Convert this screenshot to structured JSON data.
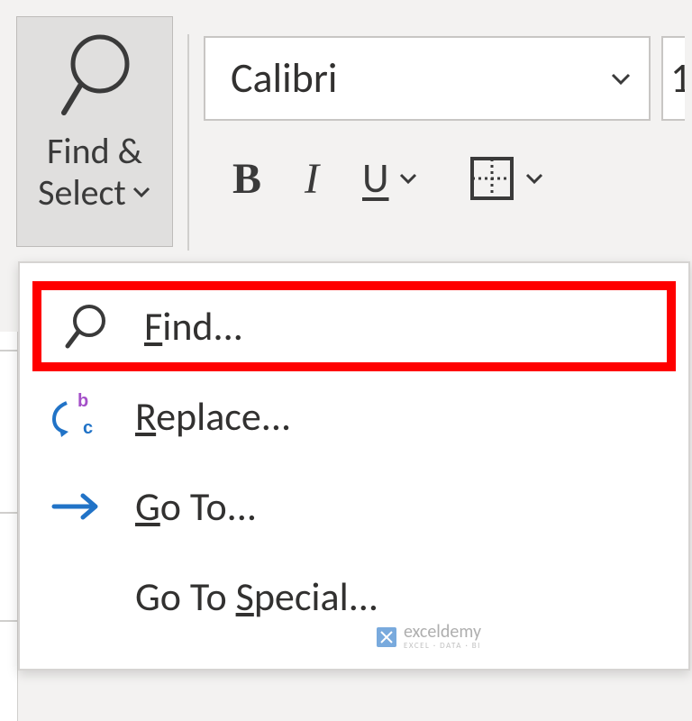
{
  "ribbon": {
    "findSelect": {
      "line1": "Find &",
      "line2": "Select"
    },
    "fontSelector": {
      "name": "Calibri"
    },
    "fontSize": "1",
    "formatButtons": {
      "bold": "B",
      "italic": "I",
      "underline": "U"
    }
  },
  "menu": {
    "items": [
      {
        "label_prefix": "",
        "label_under": "F",
        "label_suffix": "ind...",
        "icon": "search",
        "highlighted": true
      },
      {
        "label_prefix": "",
        "label_under": "R",
        "label_suffix": "eplace...",
        "icon": "replace",
        "highlighted": false
      },
      {
        "label_prefix": "",
        "label_under": "G",
        "label_suffix": "o To...",
        "icon": "arrow-right",
        "highlighted": false
      },
      {
        "label_prefix": "Go To ",
        "label_under": "S",
        "label_suffix": "pecial...",
        "icon": "none",
        "highlighted": false
      }
    ]
  },
  "watermark": {
    "brand": "exceldemy",
    "tagline": "EXCEL · DATA · BI"
  }
}
